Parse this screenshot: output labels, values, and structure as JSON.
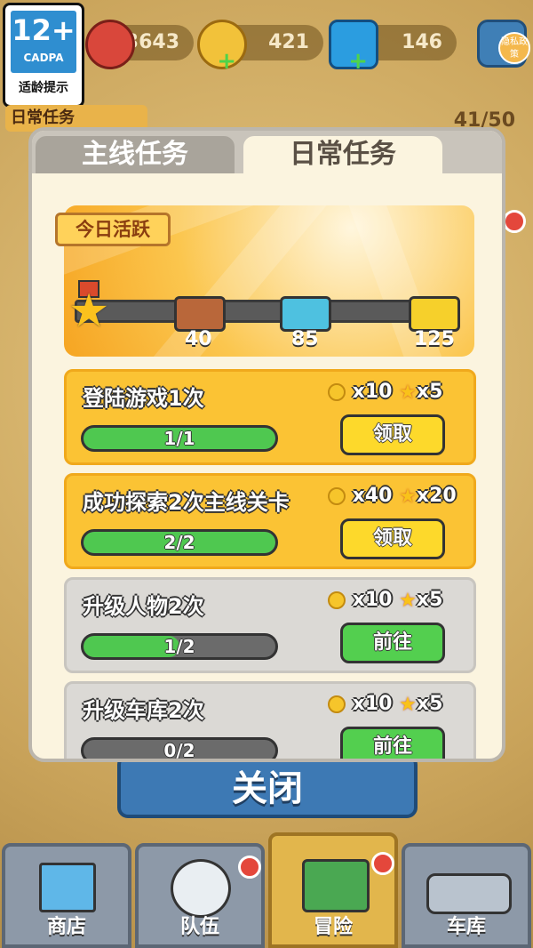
{
  "age_rating": {
    "number": "12+",
    "org": "CADPA",
    "tip": "适龄提示"
  },
  "resources": {
    "gloves": "3643",
    "skull_coins": "421",
    "gems": "146"
  },
  "settings": {
    "privacy_label": "隐私政策"
  },
  "background": {
    "mission_label": "日常任务",
    "counter": "41/50"
  },
  "modal": {
    "tabs": [
      {
        "label": "主线任务"
      },
      {
        "label": "日常任务"
      }
    ],
    "activity": {
      "label": "今日活跃",
      "milestones": [
        {
          "value": "40"
        },
        {
          "value": "85"
        },
        {
          "value": "125"
        }
      ]
    },
    "tasks": [
      {
        "title": "登陆游戏1次",
        "coin": "x10",
        "star": "x5",
        "progress_text": "1/1",
        "progress": 1.0,
        "button": "领取",
        "state": "claim"
      },
      {
        "title": "成功探索2次主线关卡",
        "coin": "x40",
        "star": "x20",
        "progress_text": "2/2",
        "progress": 1.0,
        "button": "领取",
        "state": "claim"
      },
      {
        "title": "升级人物2次",
        "coin": "x10",
        "star": "x5",
        "progress_text": "1/2",
        "progress": 0.5,
        "button": "前往",
        "state": "go"
      },
      {
        "title": "升级车库2次",
        "coin": "x10",
        "star": "x5",
        "progress_text": "0/2",
        "progress": 0.0,
        "button": "前往",
        "state": "go"
      }
    ]
  },
  "close_label": "关闭",
  "nav": [
    {
      "label": "商店"
    },
    {
      "label": "队伍"
    },
    {
      "label": "冒险"
    },
    {
      "label": "车库"
    }
  ],
  "colors": {
    "gold": "#fbc334",
    "green": "#4fc850",
    "grey": "#dbd9d5",
    "blue": "#3d79b4"
  }
}
